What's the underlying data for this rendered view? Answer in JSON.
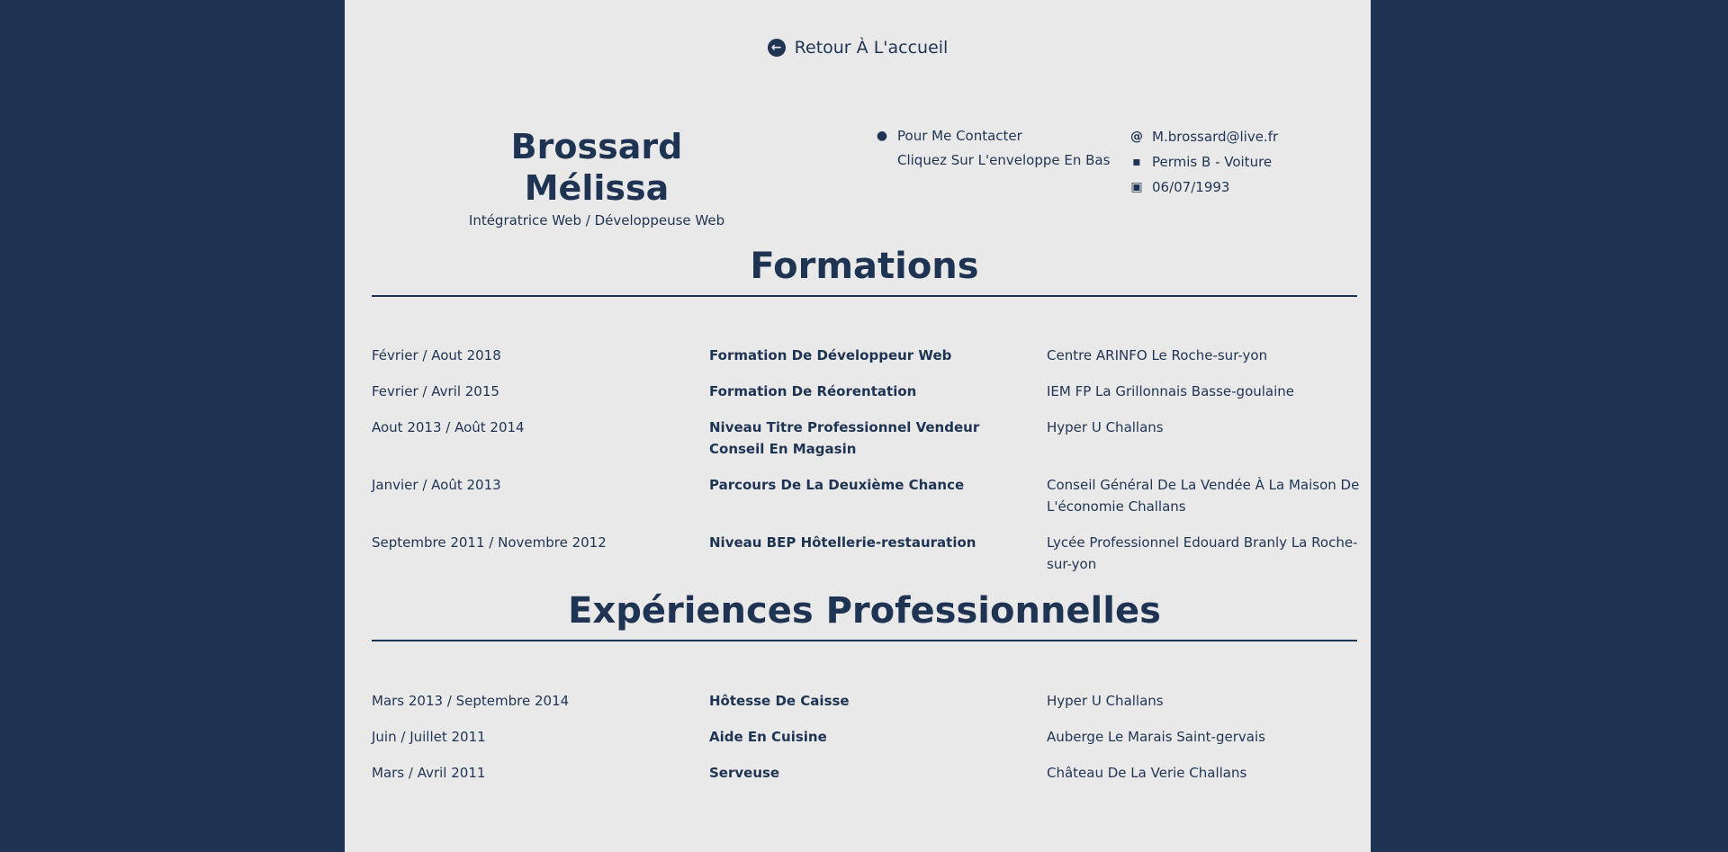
{
  "nav": {
    "back_label": "Retour À L'accueil"
  },
  "profile": {
    "name": "Brossard Mélissa",
    "role": "Intégratrice Web / Développeuse Web"
  },
  "contact": {
    "line1": "Pour Me Contacter",
    "line2": "Cliquez Sur L'enveloppe En Bas"
  },
  "info": {
    "email": "M.brossard@live.fr",
    "permis": "Permis B - Voiture",
    "birthdate": "06/07/1993"
  },
  "formations": {
    "title": "Formations",
    "rows": [
      {
        "date": "Février / Aout 2018",
        "title": "Formation De Développeur Web",
        "place": "Centre ARINFO Le Roche-sur-yon"
      },
      {
        "date": "Fevrier / Avril 2015",
        "title": "Formation De Réorentation",
        "place": "IEM FP La Grillonnais Basse-goulaine"
      },
      {
        "date": "Aout 2013 / Août 2014",
        "title": "Niveau Titre Professionnel Vendeur Conseil En Magasin",
        "place": "Hyper U Challans"
      },
      {
        "date": "Janvier / Août 2013",
        "title": "Parcours De La Deuxième Chance",
        "place": "Conseil Général De La Vendée À La Maison De L'économie Challans"
      },
      {
        "date": "Septembre 2011 / Novembre 2012",
        "title": "Niveau BEP Hôtellerie-restauration",
        "place": "Lycée Professionnel Edouard Branly La Roche-sur-yon"
      }
    ]
  },
  "experiences": {
    "title": "Expériences Professionnelles",
    "rows": [
      {
        "date": "Mars 2013 / Septembre 2014",
        "title": "Hôtesse De Caisse",
        "place": "Hyper U Challans"
      },
      {
        "date": "Juin / Juillet 2011",
        "title": "Aide En Cuisine",
        "place": "Auberge Le Marais Saint-gervais"
      },
      {
        "date": "Mars / Avril 2011",
        "title": "Serveuse",
        "place": "Château De La Verie Challans"
      }
    ]
  },
  "icons": {
    "back": "arrow-circle-left-icon",
    "location": "map-marker-icon",
    "email": "at-icon",
    "car": "car-icon",
    "birthday": "birthday-cake-icon"
  },
  "colors": {
    "background": "#1f3453",
    "paper": "#e9e9e9",
    "text": "#1f3453"
  }
}
